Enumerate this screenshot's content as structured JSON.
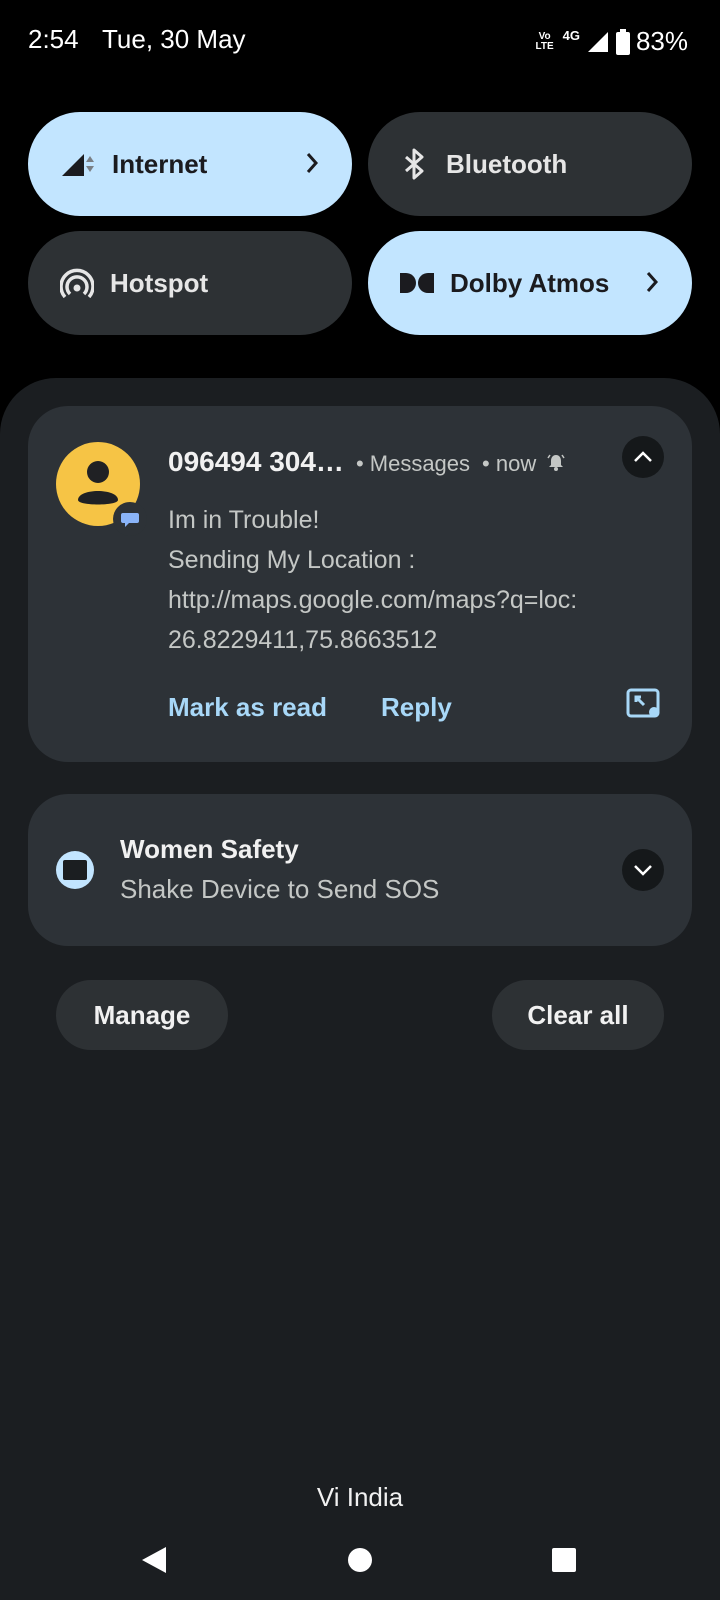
{
  "status_bar": {
    "time": "2:54",
    "date": "Tue, 30 May",
    "volte_top": "Vo",
    "volte_bottom": "LTE",
    "network_type": "4G",
    "battery_percent": "83%",
    "battery_level": 0.83,
    "icons": [
      "volte-icon",
      "signal-icon",
      "battery-icon"
    ]
  },
  "quick_tiles": [
    {
      "label": "Internet",
      "icon": "cellular-signal-icon",
      "active": true,
      "has_chevron": true
    },
    {
      "label": "Bluetooth",
      "icon": "bluetooth-icon",
      "active": false,
      "has_chevron": false
    },
    {
      "label": "Hotspot",
      "icon": "hotspot-icon",
      "active": false,
      "has_chevron": false
    },
    {
      "label": "Dolby Atmos",
      "icon": "dolby-icon",
      "active": true,
      "has_chevron": true
    }
  ],
  "message_notification": {
    "sender": "096494 304…",
    "app": "• Messages",
    "time": "• now",
    "body_lines": [
      "Im in Trouble!",
      "Sending My Location :",
      "http://maps.google.com/maps?q=loc:",
      "26.8229411,75.8663512"
    ],
    "actions": {
      "mark_as_read": "Mark as read",
      "reply": "Reply"
    },
    "icons": [
      "avatar-icon",
      "messages-badge-icon",
      "alarm-bell-icon",
      "chevron-up-icon",
      "open-bubble-icon"
    ]
  },
  "app_notification": {
    "title": "Women Safety",
    "text": "Shake Device to Send SOS",
    "icons": [
      "app-icon",
      "chevron-down-icon"
    ]
  },
  "buttons": {
    "manage": "Manage",
    "clear_all": "Clear all"
  },
  "carrier": "Vi India",
  "navigation": [
    "back-icon",
    "home-icon",
    "recents-icon"
  ],
  "colors": {
    "tile_active": "#c2e5ff",
    "tile_inactive": "#2d3134",
    "accent_text": "#a8d8f8",
    "avatar": "#f6c445",
    "card": "#2d3237",
    "shade": "#1b1e21"
  }
}
